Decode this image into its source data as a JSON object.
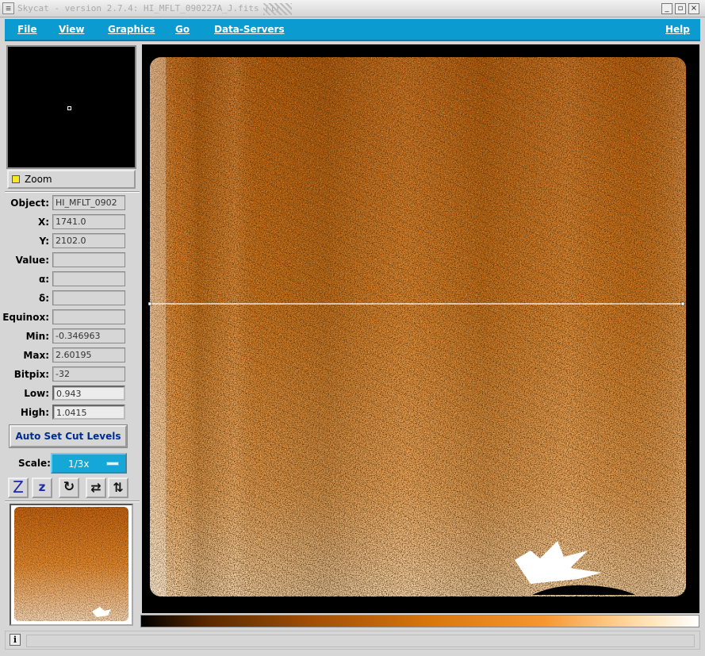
{
  "window": {
    "title": "Skycat - version 2.7.4: HI_MFLT_090227A_J.fits (1)",
    "buttons": {
      "minimize": "_",
      "maximize": "▫",
      "close": "×"
    }
  },
  "menu": {
    "file": "File",
    "view": "View",
    "graphics": "Graphics",
    "go": "Go",
    "data_servers": "Data-Servers",
    "help": "Help"
  },
  "zoom": {
    "label": "Zoom",
    "checked": true
  },
  "info": {
    "object": {
      "label": "Object:",
      "value": "HI_MFLT_0902"
    },
    "x": {
      "label": "X:",
      "value": "1741.0"
    },
    "y": {
      "label": "Y:",
      "value": "2102.0"
    },
    "value": {
      "label": "Value:",
      "value": ""
    },
    "alpha": {
      "label": "α:",
      "value": ""
    },
    "delta": {
      "label": "δ:",
      "value": ""
    },
    "equinox": {
      "label": "Equinox:",
      "value": ""
    },
    "min": {
      "label": "Min:",
      "value": "-0.346963"
    },
    "max": {
      "label": "Max:",
      "value": "2.60195"
    },
    "bitpix": {
      "label": "Bitpix:",
      "value": "-32"
    },
    "low": {
      "label": "Low:",
      "value": "0.943"
    },
    "high": {
      "label": "High:",
      "value": "1.0415"
    }
  },
  "auto_set_cut_levels": "Auto Set Cut Levels",
  "scale": {
    "label": "Scale:",
    "value": "1/3x"
  },
  "toolbar": {
    "zoom_in": "Z",
    "zoom_out": "z",
    "rotate": "↻",
    "flip_x": "⇄",
    "flip_y": "⇅"
  },
  "status": {
    "info_icon": "i",
    "message": ""
  },
  "colors": {
    "menubar": "#0b9bd0",
    "image_orange": "#e07a16",
    "background": "#d6d6d6"
  },
  "icons": {
    "window_icon": "window-menu-icon",
    "status_icon": "info-icon"
  }
}
